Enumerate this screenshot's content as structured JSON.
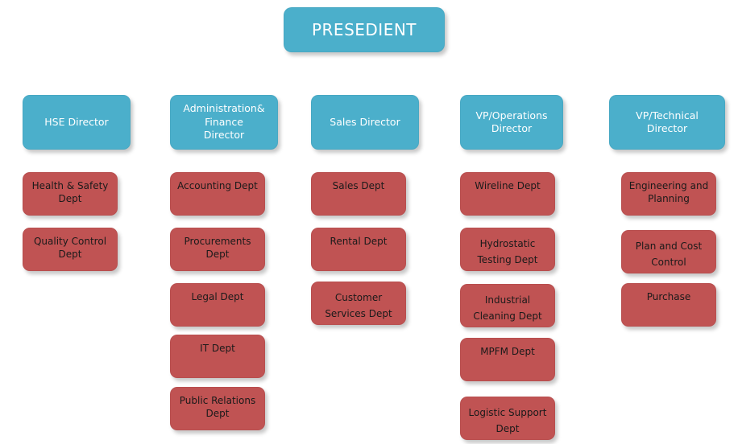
{
  "chart_data": {
    "type": "diagram",
    "title": "Organizational Chart",
    "colors": {
      "executive_fill": "#4BAFCB",
      "department_fill": "#C05353",
      "executive_text": "#FFFFFF",
      "department_text": "#1A1A1A",
      "background": "#FFFFFF"
    },
    "root": {
      "label": "PRESEDIENT",
      "level": 0
    },
    "columns": [
      {
        "director": "HSE Director",
        "departments": [
          "Health & Safety\nDept",
          "Quality Control\nDept"
        ]
      },
      {
        "director": "Administration&\nFinance\nDirector",
        "departments": [
          "Accounting  Dept",
          "Procurements\nDept",
          "Legal Dept",
          "IT Dept",
          "Public Relations\nDept"
        ]
      },
      {
        "director": "Sales Director",
        "departments": [
          "Sales Dept",
          "Rental Dept",
          "Customer\nServices Dept"
        ]
      },
      {
        "director": "VP/Operations\nDirector",
        "departments": [
          "Wireline  Dept",
          "Hydrostatic\nTesting Dept",
          "Industrial\nCleaning Dept",
          "MPFM Dept",
          "Logistic Support\nDept"
        ]
      },
      {
        "director": "VP/Technical\nDirector",
        "departments": [
          "Engineering and\nPlanning",
          "Plan and Cost\nControl",
          "Purchase"
        ]
      }
    ]
  },
  "nodes": {
    "president": "PRESEDIENT",
    "dir_hse": "HSE Director",
    "dir_admin": "Administration&\nFinance\nDirector",
    "dir_sales": "Sales Director",
    "dir_ops": "VP/Operations\nDirector",
    "dir_tech": "VP/Technical\nDirector",
    "hse_1": "Health & Safety\nDept",
    "hse_2": "Quality Control\nDept",
    "admin_1": "Accounting  Dept",
    "admin_2": "Procurements\nDept",
    "admin_3": "Legal Dept",
    "admin_4": "IT Dept",
    "admin_5": "Public Relations\nDept",
    "sales_1": "Sales Dept",
    "sales_2": "Rental Dept",
    "sales_3": "Customer\nServices Dept",
    "ops_1": "Wireline  Dept",
    "ops_2": "Hydrostatic\nTesting Dept",
    "ops_3": "Industrial\nCleaning Dept",
    "ops_4": "MPFM Dept",
    "ops_5": "Logistic Support\nDept",
    "tech_1": "Engineering and\nPlanning",
    "tech_2": "Plan and Cost\nControl",
    "tech_3": "Purchase"
  }
}
